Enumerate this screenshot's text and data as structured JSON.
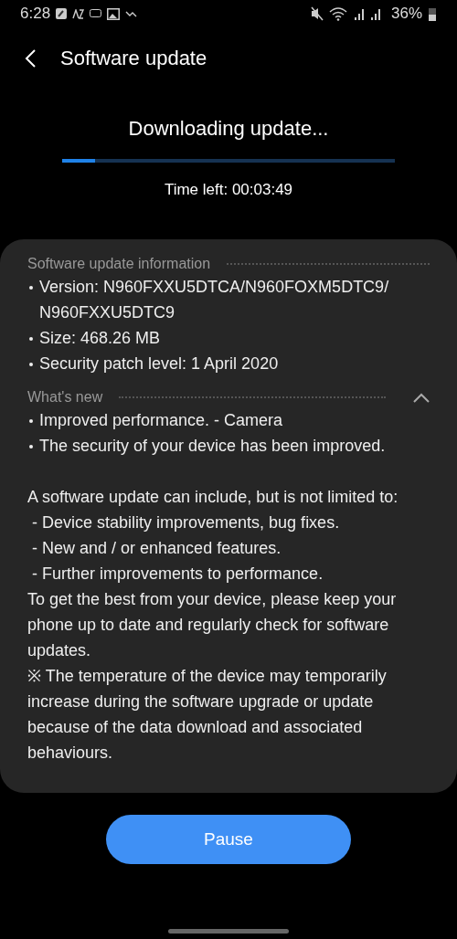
{
  "status_bar": {
    "time": "6:28",
    "battery": "36%"
  },
  "header": {
    "title": "Software update"
  },
  "download": {
    "title": "Downloading update...",
    "level": 0.1,
    "time_left": "Time left: 00:03:49"
  },
  "info": {
    "heading": "Software update information",
    "items": [
      "Version: N960FXXU5DTCA/N960FOXM5DTC9/ N960FXXU5DTC9",
      "Size: 468.26 MB",
      "Security patch level: 1 April 2020"
    ]
  },
  "whats_new": {
    "heading": "What's new",
    "expanded": true,
    "items": [
      "Improved performance. - Camera",
      "The security of your device has been improved."
    ],
    "paragraphs": [
      "A software update can include, but is not limited to:",
      " - Device stability improvements, bug fixes.",
      " - New and / or enhanced features.",
      " - Further improvements to performance.",
      "To get the best from your device, please keep your phone up to date and regularly check for software updates.",
      "※ The temperature of the device may temporarily increase during the software upgrade or update because of the data download and associated behaviours."
    ]
  },
  "buttons": [
    {
      "label": "Pause"
    }
  ]
}
